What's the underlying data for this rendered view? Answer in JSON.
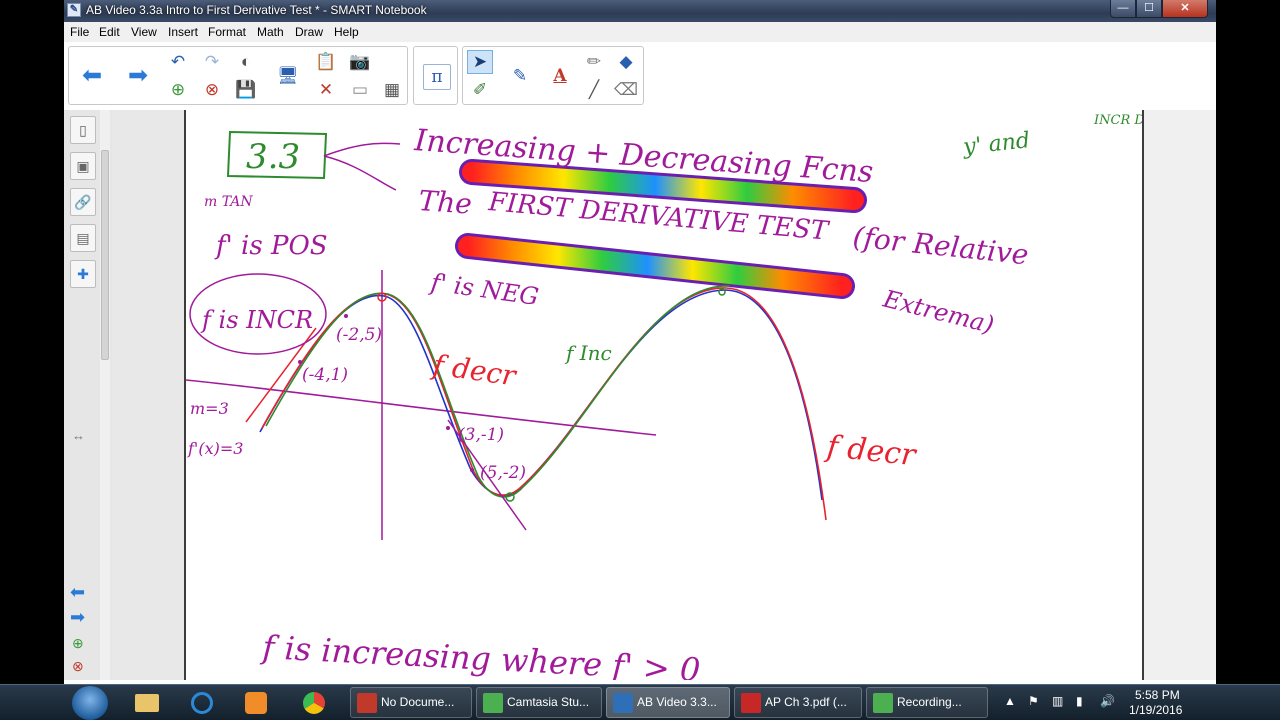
{
  "window": {
    "title": "AB Video 3.3a Intro to First Derivative Test * - SMART Notebook",
    "controls": {
      "minimize": "—",
      "maximize": "☐",
      "close": "✕"
    }
  },
  "menu": {
    "items": [
      "File",
      "Edit",
      "View",
      "Insert",
      "Format",
      "Math",
      "Draw",
      "Help"
    ]
  },
  "toolbar": {
    "buttons": [
      "back-arrow-icon",
      "forward-arrow-icon",
      "undo-icon",
      "redo-icon",
      "add-page-icon",
      "delete-page-icon",
      "properties-icon",
      "save-icon",
      "screen-shade-icon",
      "paste-icon",
      "clear-icon",
      "camera-icon",
      "display-icon",
      "table-icon",
      "math-icon",
      "select-icon",
      "pen-icon",
      "creative-pen-icon",
      "text-icon",
      "eraser-icon",
      "line-icon",
      "fill-icon",
      "shapes-icon"
    ],
    "math_symbol": "π",
    "text_tool_label": "A"
  },
  "sidebar": {
    "tabs": [
      "page-sorter-icon",
      "gallery-icon",
      "attachments-icon",
      "properties-icon",
      "addons-icon"
    ]
  },
  "canvas": {
    "lesson_number": "3.3",
    "handwriting": {
      "title": "Increasing + Decreasing Fcns",
      "subtitle_1": "The",
      "subtitle_2": "FIRST DERIVATIVE TEST",
      "subtitle_3": "(for Relative",
      "subtitle_4": "Extrema)",
      "yprime_note": "y' and",
      "incr_decr": "INCR\nDECR",
      "m_tan": "m TAN",
      "fprime_pos": "f' is POS",
      "fprime_neg": "f' is NEG",
      "f_is_incr": "f is INCR",
      "f_inc": "f Inc",
      "f_decr_1": "f decr",
      "f_decr_2": "f decr",
      "point_1": "(-2,5)",
      "point_2": "(-4,1)",
      "point_3": "(3,-1)",
      "point_4": "(5,-2)",
      "slope_note": "m=3",
      "fprime_value": "f'(x)=3",
      "bottom_line": "f is increasing where f' > 0"
    }
  },
  "taskbar": {
    "pinned": [
      "start-icon",
      "folder-icon",
      "ie-icon",
      "media-icon",
      "chrome-icon"
    ],
    "tasks": [
      {
        "label": "No Docume...",
        "color": "#c0392b",
        "active": false
      },
      {
        "label": "Camtasia Stu...",
        "color": "#4caf50",
        "active": false
      },
      {
        "label": "AB Video 3.3...",
        "color": "#2e6fb7",
        "active": true
      },
      {
        "label": "AP Ch 3.pdf (...",
        "color": "#c62828",
        "active": false
      },
      {
        "label": "Recording...",
        "color": "#4caf50",
        "active": false
      }
    ],
    "clock_time": "5:58 PM",
    "clock_date": "1/19/2016"
  },
  "colors": {
    "pen_green": "#2e8b2e",
    "pen_purple": "#8b1a8b",
    "pen_red": "#e8222e",
    "pen_blue": "#2233cc"
  }
}
